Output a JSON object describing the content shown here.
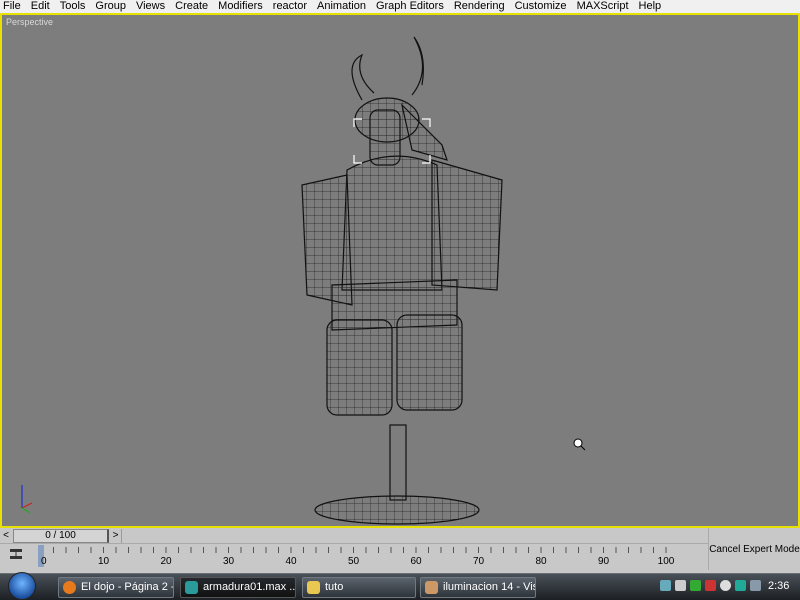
{
  "menu": [
    "File",
    "Edit",
    "Tools",
    "Group",
    "Views",
    "Create",
    "Modifiers",
    "reactor",
    "Animation",
    "Graph Editors",
    "Rendering",
    "Customize",
    "MAXScript",
    "Help"
  ],
  "viewport": {
    "label": "Perspective",
    "border_color": "#e8e000",
    "background": "#7d7d7d"
  },
  "timeslider": {
    "prev": "<",
    "value": "0 / 100",
    "next": ">",
    "current_frame": 0,
    "total_frames": 100
  },
  "trackbar": {
    "ticks": [
      "0",
      "10",
      "20",
      "30",
      "40",
      "50",
      "60",
      "70",
      "80",
      "90",
      "100"
    ]
  },
  "expert": {
    "label": "Cancel Expert Mode"
  },
  "taskbar": {
    "items": [
      {
        "label": "El dojo - Página 2 - ...",
        "icon": "firefox-icon",
        "active": false
      },
      {
        "label": "armadura01.max",
        "extra": "...",
        "icon": "3dsmax-icon",
        "active": true
      },
      {
        "label": "tuto",
        "icon": "folder-icon",
        "active": false
      },
      {
        "label": "iluminacion 14 - Vis...",
        "icon": "visio-icon",
        "active": false
      }
    ],
    "clock": "2:36"
  }
}
